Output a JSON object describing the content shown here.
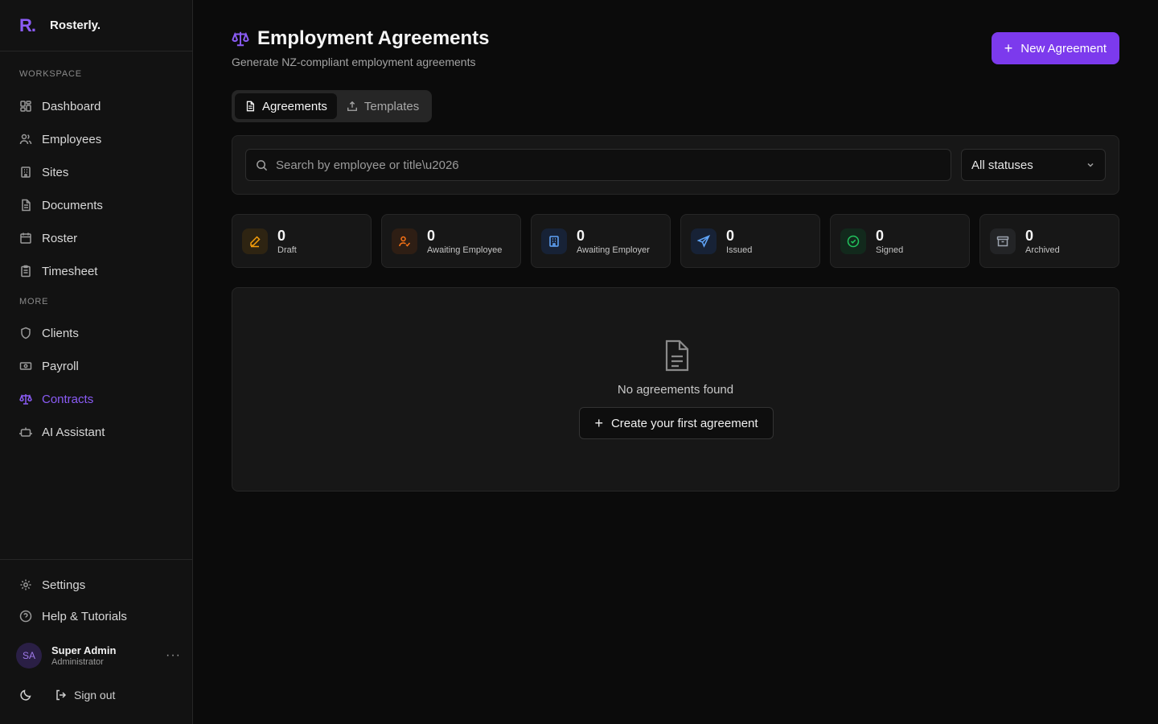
{
  "brand": {
    "logo": "R.",
    "name": "Rosterly."
  },
  "sidebar": {
    "workspace_label": "WORKSPACE",
    "more_label": "MORE",
    "workspace_items": [
      {
        "label": "Dashboard",
        "icon": "dashboard-icon"
      },
      {
        "label": "Employees",
        "icon": "users-icon"
      },
      {
        "label": "Sites",
        "icon": "building-icon"
      },
      {
        "label": "Documents",
        "icon": "document-icon"
      },
      {
        "label": "Roster",
        "icon": "calendar-icon"
      },
      {
        "label": "Timesheet",
        "icon": "clipboard-icon"
      }
    ],
    "more_items": [
      {
        "label": "Clients",
        "icon": "shield-icon"
      },
      {
        "label": "Payroll",
        "icon": "banknote-icon"
      },
      {
        "label": "Contracts",
        "icon": "scale-icon",
        "active": true
      },
      {
        "label": "AI Assistant",
        "icon": "bot-icon"
      }
    ],
    "footer": {
      "settings": "Settings",
      "help": "Help & Tutorials",
      "user_initials": "SA",
      "user_name": "Super Admin",
      "user_role": "Administrator",
      "more": "···",
      "sign_out": "Sign out"
    }
  },
  "header": {
    "title": "Employment Agreements",
    "subtitle": "Generate NZ-compliant employment agreements",
    "new_button": "New Agreement"
  },
  "tabs": [
    {
      "label": "Agreements",
      "active": true
    },
    {
      "label": "Templates",
      "active": false
    }
  ],
  "filters": {
    "search_placeholder": "Search by employee or title\\u2026",
    "status_selected": "All statuses"
  },
  "stats": [
    {
      "value": "0",
      "label": "Draft",
      "icon": "pencil-icon",
      "color": "#f59e0b",
      "bg": "#2e2412"
    },
    {
      "value": "0",
      "label": "Awaiting Employee",
      "icon": "user-check-icon",
      "color": "#f97316",
      "bg": "#2e1e14"
    },
    {
      "value": "0",
      "label": "Awaiting Employer",
      "icon": "building-icon",
      "color": "#60a5fa",
      "bg": "#172236"
    },
    {
      "value": "0",
      "label": "Issued",
      "icon": "send-icon",
      "color": "#60a5fa",
      "bg": "#172236"
    },
    {
      "value": "0",
      "label": "Signed",
      "icon": "check-circle-icon",
      "color": "#22c55e",
      "bg": "#12291c"
    },
    {
      "value": "0",
      "label": "Archived",
      "icon": "archive-icon",
      "color": "#9ca3af",
      "bg": "#232426"
    }
  ],
  "empty_state": {
    "message": "No agreements found",
    "button": "Create your first agreement"
  },
  "colors": {
    "accent": "#7c3aed",
    "background": "#0b0b0b",
    "panel": "#171717"
  }
}
